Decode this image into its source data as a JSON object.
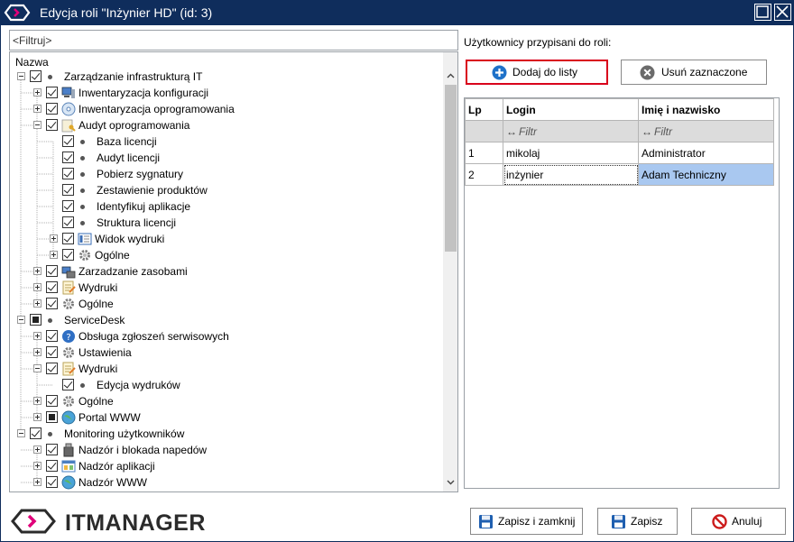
{
  "window": {
    "title": "Edycja roli \"Inżynier HD\" (id: 3)"
  },
  "tree": {
    "filter_placeholder": "<Filtruj>",
    "header": "Nazwa",
    "rows": [
      {
        "label": "Zarządzanie infrastrukturą IT",
        "level": 0,
        "expander": "minus",
        "check": "checked",
        "marker": "dot"
      },
      {
        "label": "Inwentaryzacja konfiguracji",
        "level": 1,
        "expander": "plus",
        "check": "checked",
        "marker": "computer-icon"
      },
      {
        "label": "Inwentaryzacja oprogramowania",
        "level": 1,
        "expander": "plus",
        "check": "checked",
        "marker": "software-disc-icon"
      },
      {
        "label": "Audyt oprogramowania",
        "level": 1,
        "expander": "minus",
        "check": "checked",
        "marker": "audit-key-icon"
      },
      {
        "label": "Baza licencji",
        "level": 2,
        "expander": "none",
        "check": "checked",
        "marker": "dot"
      },
      {
        "label": "Audyt licencji",
        "level": 2,
        "expander": "none",
        "check": "checked",
        "marker": "dot"
      },
      {
        "label": "Pobierz sygnatury",
        "level": 2,
        "expander": "none",
        "check": "checked",
        "marker": "dot"
      },
      {
        "label": "Zestawienie produktów",
        "level": 2,
        "expander": "none",
        "check": "checked",
        "marker": "dot"
      },
      {
        "label": "Identyfikuj aplikacje",
        "level": 2,
        "expander": "none",
        "check": "checked",
        "marker": "dot"
      },
      {
        "label": "Struktura licencji",
        "level": 2,
        "expander": "none",
        "check": "checked",
        "marker": "dot"
      },
      {
        "label": "Widok wydruki",
        "level": 2,
        "expander": "plus",
        "check": "checked",
        "marker": "print-view-icon"
      },
      {
        "label": "Ogólne",
        "level": 2,
        "expander": "plus",
        "check": "checked",
        "marker": "gear-icon"
      },
      {
        "label": "Zarzadzanie zasobami",
        "level": 1,
        "expander": "plus",
        "check": "checked",
        "marker": "assets-icon"
      },
      {
        "label": "Wydruki",
        "level": 1,
        "expander": "plus",
        "check": "checked",
        "marker": "report-icon"
      },
      {
        "label": "Ogólne",
        "level": 1,
        "expander": "plus",
        "check": "checked",
        "marker": "gear-icon"
      },
      {
        "label": "ServiceDesk",
        "level": 0,
        "expander": "minus",
        "check": "partial",
        "marker": "dot"
      },
      {
        "label": "Obsługa zgłoszeń serwisowych",
        "level": 1,
        "expander": "plus",
        "check": "checked",
        "marker": "help-icon"
      },
      {
        "label": "Ustawienia",
        "level": 1,
        "expander": "plus",
        "check": "checked",
        "marker": "gear-icon"
      },
      {
        "label": "Wydruki",
        "level": 1,
        "expander": "minus",
        "check": "checked",
        "marker": "report-icon"
      },
      {
        "label": "Edycja wydruków",
        "level": 2,
        "expander": "none",
        "check": "checked",
        "marker": "dot"
      },
      {
        "label": "Ogólne",
        "level": 1,
        "expander": "plus",
        "check": "checked",
        "marker": "gear-icon"
      },
      {
        "label": "Portal WWW",
        "level": 1,
        "expander": "plus",
        "check": "partial",
        "marker": "globe-icon"
      },
      {
        "label": "Monitoring użytkowników",
        "level": 0,
        "expander": "minus",
        "check": "checked",
        "marker": "dot"
      },
      {
        "label": "Nadzór i blokada napedów",
        "level": 1,
        "expander": "plus",
        "check": "checked",
        "marker": "usb-drive-icon"
      },
      {
        "label": "Nadzór aplikacji",
        "level": 1,
        "expander": "plus",
        "check": "checked",
        "marker": "app-window-icon"
      },
      {
        "label": "Nadzór WWW",
        "level": 1,
        "expander": "plus",
        "check": "checked",
        "marker": "globe-icon"
      }
    ]
  },
  "users_panel": {
    "label": "Użytkownicy przypisani do roli:",
    "add_button": "Dodaj do listy",
    "remove_button": "Usuń zaznaczone",
    "columns": [
      "Lp",
      "Login",
      "Imię i nazwisko"
    ],
    "filter_text": "Filtr",
    "rows": [
      {
        "lp": "1",
        "login": "mikolaj",
        "name": "Administrator"
      },
      {
        "lp": "2",
        "login": "inżynier",
        "name": "Adam Techniczny"
      }
    ],
    "selected_row": 1
  },
  "footer": {
    "brand": "ITMANAGER",
    "save_close_button": "Zapisz i zamknij",
    "save_button": "Zapisz",
    "cancel_button": "Anuluj"
  },
  "colors": {
    "titlebar": "#0f2d5c",
    "highlight": "#d9001b",
    "selection": "#a9c8f0"
  }
}
